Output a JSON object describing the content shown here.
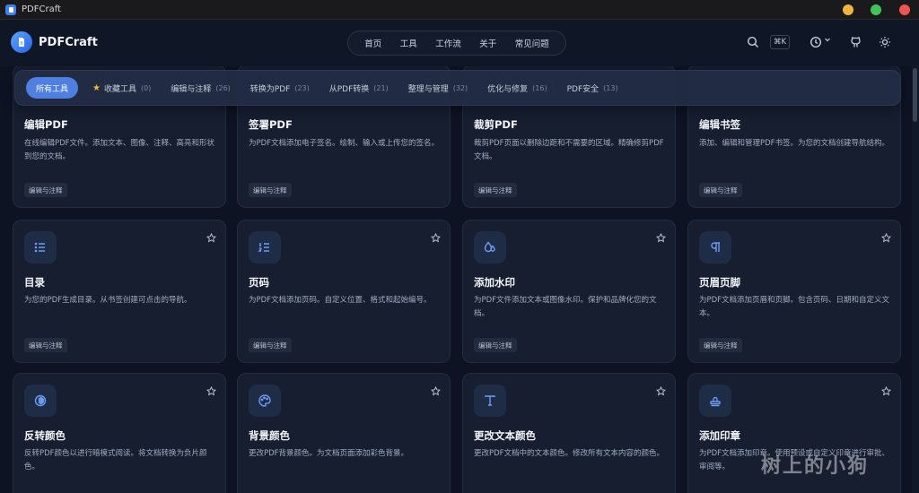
{
  "window": {
    "title": "PDFCraft"
  },
  "header": {
    "brand": "PDFCraft",
    "nav": [
      "首页",
      "工具",
      "工作流",
      "关于",
      "常见问题"
    ],
    "shortcut": "⌘K"
  },
  "filters": [
    {
      "label": "所有工具",
      "count": ""
    },
    {
      "label": "收藏工具",
      "count": "(0)"
    },
    {
      "label": "编辑与注释",
      "count": "(26)"
    },
    {
      "label": "转换为PDF",
      "count": "(23)"
    },
    {
      "label": "从PDF转换",
      "count": "(21)"
    },
    {
      "label": "整理与管理",
      "count": "(32)"
    },
    {
      "label": "优化与修复",
      "count": "(16)"
    },
    {
      "label": "PDF安全",
      "count": "(13)"
    }
  ],
  "cards": [
    {
      "title": "编辑PDF",
      "desc": "在线编辑PDF文件。添加文本、图像、注释、高亮和形状到您的文档。",
      "tag": "编辑与注释",
      "icon": "edit-icon"
    },
    {
      "title": "签署PDF",
      "desc": "为PDF文档添加电子签名。绘制、输入或上传您的签名。",
      "tag": "编辑与注释",
      "icon": "signature-icon"
    },
    {
      "title": "裁剪PDF",
      "desc": "裁剪PDF页面以删除边距和不需要的区域。精确修剪PDF文档。",
      "tag": "编辑与注释",
      "icon": "crop-icon"
    },
    {
      "title": "编辑书签",
      "desc": "添加、编辑和管理PDF书签。为您的文档创建导航结构。",
      "tag": "编辑与注释",
      "icon": "bookmark-icon"
    },
    {
      "title": "目录",
      "desc": "为您的PDF生成目录。从书签创建可点击的导航。",
      "tag": "编辑与注释",
      "icon": "list-icon"
    },
    {
      "title": "页码",
      "desc": "为PDF文档添加页码。自定义位置、格式和起始编号。",
      "tag": "编辑与注释",
      "icon": "numbered-list-icon"
    },
    {
      "title": "添加水印",
      "desc": "为PDF文件添加文本或图像水印。保护和品牌化您的文档。",
      "tag": "编辑与注释",
      "icon": "droplet-icon"
    },
    {
      "title": "页眉页脚",
      "desc": "为PDF文档添加页眉和页脚。包含页码、日期和自定义文本。",
      "tag": "编辑与注释",
      "icon": "pilcrow-icon"
    },
    {
      "title": "反转颜色",
      "desc": "反转PDF颜色以进行暗模式阅读。将文档转换为负片颜色。",
      "tag": "编辑与注释",
      "icon": "invert-icon"
    },
    {
      "title": "背景颜色",
      "desc": "更改PDF背景颜色。为文档页面添加彩色背景。",
      "tag": "编辑与注释",
      "icon": "palette-icon"
    },
    {
      "title": "更改文本颜色",
      "desc": "更改PDF文档中的文本颜色。修改所有文本内容的颜色。",
      "tag": "编辑与注释",
      "icon": "type-icon"
    },
    {
      "title": "添加印章",
      "desc": "为PDF文档添加印章。使用预设或自定义印章进行审批、审阅等。",
      "tag": "编辑与注释",
      "icon": "stamp-icon"
    }
  ],
  "watermark": "树上的小狗"
}
